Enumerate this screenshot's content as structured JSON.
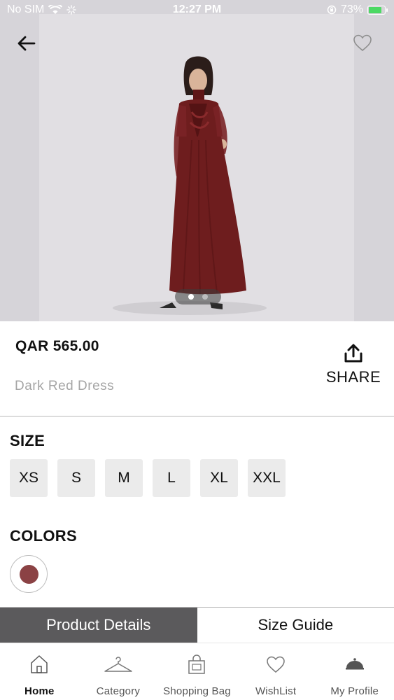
{
  "status_bar": {
    "carrier": "No SIM",
    "time": "12:27 PM",
    "battery": "73%",
    "battery_level": 0.73
  },
  "gallery": {
    "image_count": 2,
    "active_index": 0
  },
  "product": {
    "price": "QAR 565.00",
    "name": "Dark Red Dress",
    "share_label": "SHARE"
  },
  "size": {
    "label": "SIZE",
    "options": [
      "XS",
      "S",
      "M",
      "L",
      "XL",
      "XXL"
    ]
  },
  "colors": {
    "label": "COLORS",
    "swatches": [
      "#8b4244"
    ]
  },
  "tabs": [
    {
      "label": "Product Details",
      "active": true
    },
    {
      "label": "Size Guide",
      "active": false
    }
  ],
  "bottom_nav": [
    {
      "label": "Home",
      "icon": "home-icon",
      "active": true
    },
    {
      "label": "Category",
      "icon": "hanger-icon",
      "active": false
    },
    {
      "label": "Shopping Bag",
      "icon": "shopping-bag-icon",
      "active": false
    },
    {
      "label": "WishList",
      "icon": "heart-icon",
      "active": false
    },
    {
      "label": "My Profile",
      "icon": "profile-icon",
      "active": false
    }
  ],
  "colors_theme": {
    "dress": "#6e1d1e",
    "active_tab": "#5b5a5c",
    "battery": "#4cd964"
  }
}
